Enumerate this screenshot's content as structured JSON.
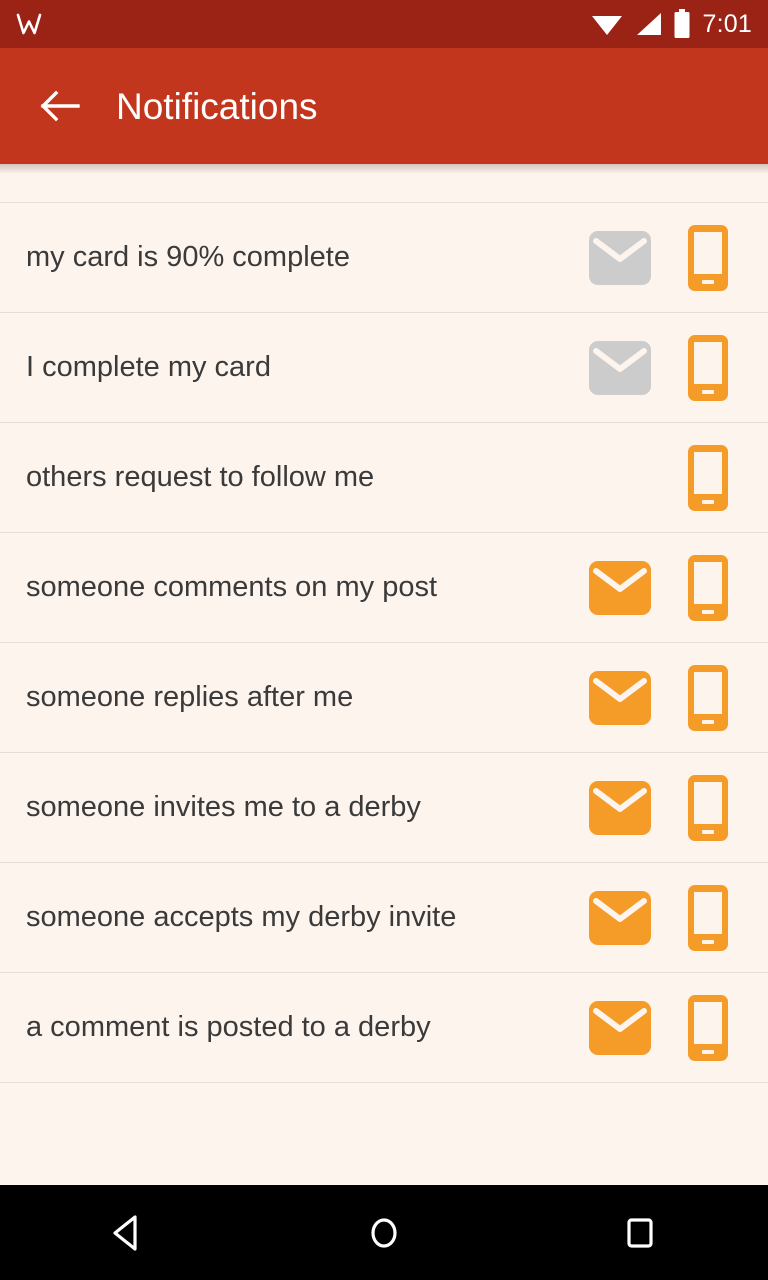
{
  "status_bar": {
    "app_icon": "w-logo-icon",
    "icons": [
      "wifi-icon",
      "cell-signal-icon",
      "battery-icon"
    ],
    "time": "7:01",
    "background_color": "#9b2315"
  },
  "toolbar": {
    "back_icon": "back-arrow-icon",
    "title": "Notifications",
    "background_color": "#c2361d",
    "text_color": "#ffffff"
  },
  "theme": {
    "page_background": "#fdf4ee",
    "divider_color": "#e6ddd8",
    "row_text_color": "#3a3a3a",
    "accent_orange": "#f59b28",
    "disabled_gray": "#cccccc"
  },
  "list": {
    "rows": [
      {
        "label": "my card is 90% complete",
        "email": {
          "present": true,
          "enabled": false,
          "icon": "email-icon"
        },
        "phone": {
          "present": true,
          "enabled": true,
          "icon": "phone-icon"
        }
      },
      {
        "label": "I complete my card",
        "email": {
          "present": true,
          "enabled": false,
          "icon": "email-icon"
        },
        "phone": {
          "present": true,
          "enabled": true,
          "icon": "phone-icon"
        }
      },
      {
        "label": "others request to follow me",
        "email": {
          "present": false,
          "enabled": false,
          "icon": "email-icon"
        },
        "phone": {
          "present": true,
          "enabled": true,
          "icon": "phone-icon"
        }
      },
      {
        "label": "someone comments on my post",
        "email": {
          "present": true,
          "enabled": true,
          "icon": "email-icon"
        },
        "phone": {
          "present": true,
          "enabled": true,
          "icon": "phone-icon"
        }
      },
      {
        "label": "someone replies after me",
        "email": {
          "present": true,
          "enabled": true,
          "icon": "email-icon"
        },
        "phone": {
          "present": true,
          "enabled": true,
          "icon": "phone-icon"
        }
      },
      {
        "label": "someone invites me to a derby",
        "email": {
          "present": true,
          "enabled": true,
          "icon": "email-icon"
        },
        "phone": {
          "present": true,
          "enabled": true,
          "icon": "phone-icon"
        }
      },
      {
        "label": "someone accepts my derby invite",
        "email": {
          "present": true,
          "enabled": true,
          "icon": "email-icon"
        },
        "phone": {
          "present": true,
          "enabled": true,
          "icon": "phone-icon"
        }
      },
      {
        "label": "a comment is posted to a derby",
        "email": {
          "present": true,
          "enabled": true,
          "icon": "email-icon"
        },
        "phone": {
          "present": true,
          "enabled": true,
          "icon": "phone-icon"
        }
      }
    ]
  },
  "nav_bar": {
    "background_color": "#000000",
    "buttons": [
      {
        "name": "back-nav-button",
        "icon": "triangle-back-icon"
      },
      {
        "name": "home-nav-button",
        "icon": "circle-home-icon"
      },
      {
        "name": "recents-nav-button",
        "icon": "square-recents-icon"
      }
    ]
  }
}
